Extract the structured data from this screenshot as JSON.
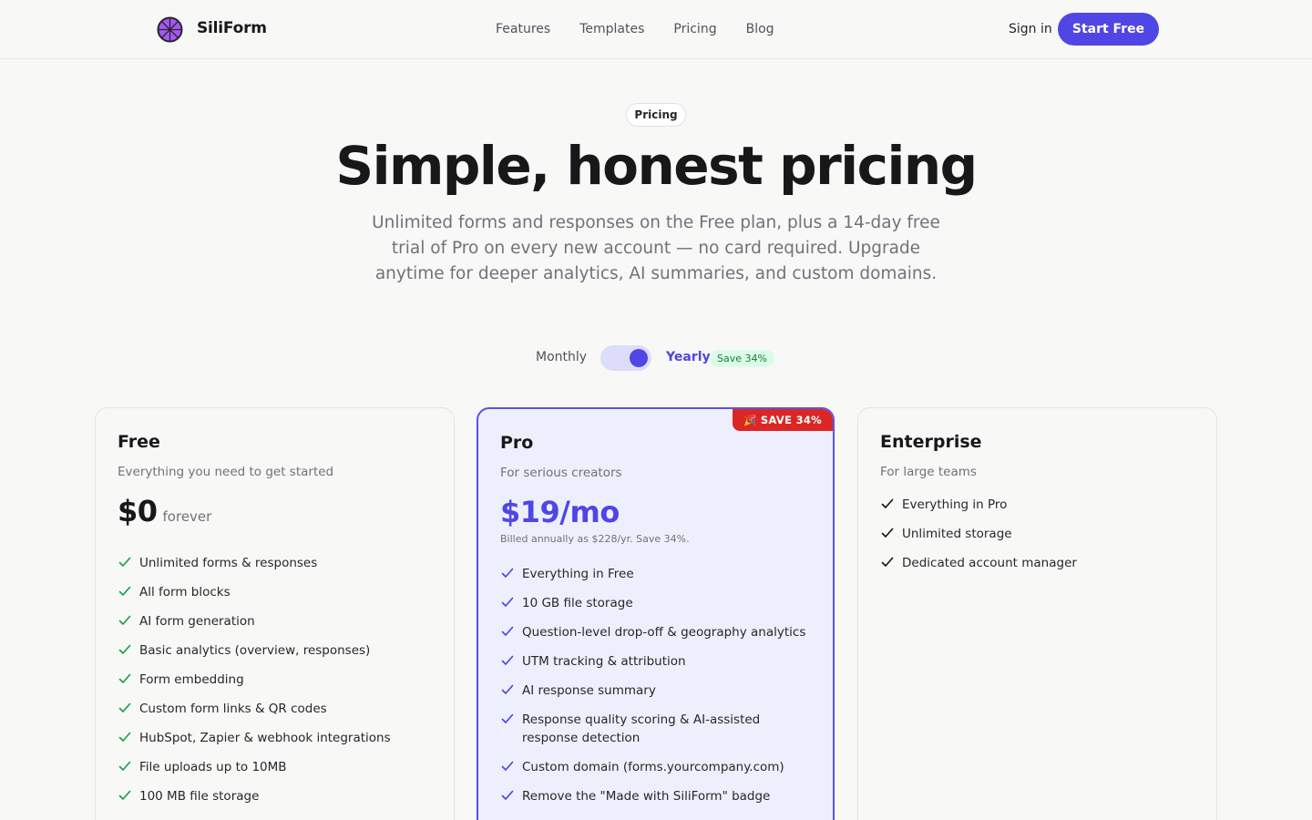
{
  "nav": {
    "brand": "SiliForm",
    "links": [
      "Features",
      "Templates",
      "Pricing",
      "Blog"
    ],
    "sign_in": "Sign in",
    "cta": "Start Free"
  },
  "hero": {
    "eyebrow": "Pricing",
    "title": "Simple, honest pricing",
    "subtitle": "Unlimited forms and responses on the Free plan, plus a 14-day free trial of Pro on every new account — no card required. Upgrade anytime for deeper analytics, AI summaries, and custom domains."
  },
  "billing": {
    "monthly_label": "Monthly",
    "yearly_label": "Yearly",
    "save_pill": "Save 34%",
    "selected": "yearly"
  },
  "plans": {
    "free": {
      "name": "Free",
      "description": "Everything you need to get started",
      "price": "$0",
      "price_suffix": "forever",
      "features": [
        "Unlimited forms & responses",
        "All form blocks",
        "AI form generation",
        "Basic analytics (overview, responses)",
        "Form embedding",
        "Custom form links & QR codes",
        "HubSpot, Zapier & webhook integrations",
        "File uploads up to 10MB",
        "100 MB file storage"
      ]
    },
    "pro": {
      "name": "Pro",
      "badge": "🎉 SAVE 34%",
      "description": "For serious creators",
      "price": "$19/mo",
      "billed_note": "Billed annually as $228/yr. Save 34%.",
      "features": [
        "Everything in Free",
        "10 GB file storage",
        "Question-level drop-off & geography analytics",
        "UTM tracking & attribution",
        "AI response summary",
        "Response quality scoring & AI-assisted response detection",
        "Custom domain (forms.yourcompany.com)",
        "Remove the \"Made with SiliForm\" badge"
      ]
    },
    "enterprise": {
      "name": "Enterprise",
      "description": "For large teams",
      "features": [
        "Everything in Pro",
        "Unlimited storage",
        "Dedicated account manager"
      ]
    }
  },
  "colors": {
    "accent": "#4f46e5",
    "check_free": "#16a34a",
    "check_pro": "#4f46e5",
    "check_enterprise": "#18181b",
    "badge": "#dc2626",
    "save_pill_bg": "#dcfce7"
  },
  "icons": {
    "logo": "siliform-logo-icon",
    "feature_check": "check-icon"
  }
}
